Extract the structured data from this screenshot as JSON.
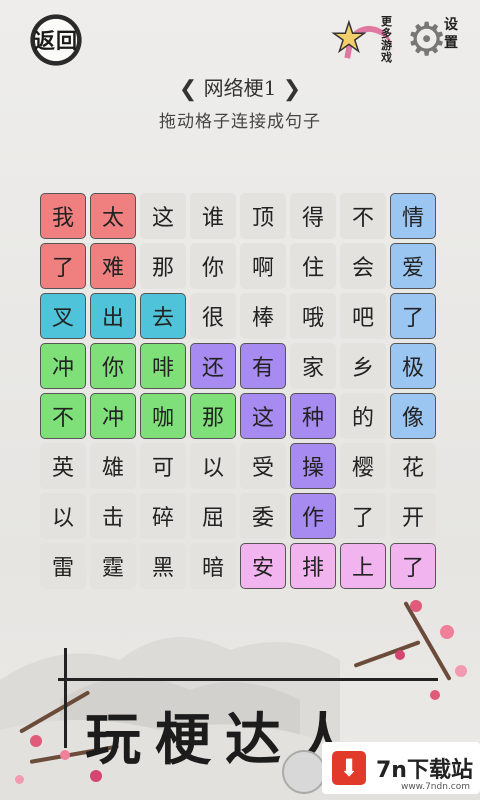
{
  "top": {
    "back_label": "返回",
    "more_games_label": "更多游戏",
    "settings_label": "设置"
  },
  "level": {
    "title": "网络梗1",
    "prev_arrow": "❮",
    "next_arrow": "❯",
    "hint": "拖动格子连接成句子"
  },
  "grid": [
    [
      {
        "t": "我",
        "c": "red"
      },
      {
        "t": "太",
        "c": "red"
      },
      {
        "t": "这",
        "c": ""
      },
      {
        "t": "谁",
        "c": ""
      },
      {
        "t": "顶",
        "c": ""
      },
      {
        "t": "得",
        "c": ""
      },
      {
        "t": "不",
        "c": ""
      },
      {
        "t": "情",
        "c": "blue"
      }
    ],
    [
      {
        "t": "了",
        "c": "red"
      },
      {
        "t": "难",
        "c": "red"
      },
      {
        "t": "那",
        "c": ""
      },
      {
        "t": "你",
        "c": ""
      },
      {
        "t": "啊",
        "c": ""
      },
      {
        "t": "住",
        "c": ""
      },
      {
        "t": "会",
        "c": ""
      },
      {
        "t": "爱",
        "c": "blue"
      }
    ],
    [
      {
        "t": "叉",
        "c": "cyan"
      },
      {
        "t": "出",
        "c": "cyan"
      },
      {
        "t": "去",
        "c": "cyan"
      },
      {
        "t": "很",
        "c": ""
      },
      {
        "t": "棒",
        "c": ""
      },
      {
        "t": "哦",
        "c": ""
      },
      {
        "t": "吧",
        "c": ""
      },
      {
        "t": "了",
        "c": "blue"
      }
    ],
    [
      {
        "t": "冲",
        "c": "green"
      },
      {
        "t": "你",
        "c": "green"
      },
      {
        "t": "啡",
        "c": "green"
      },
      {
        "t": "还",
        "c": "purple"
      },
      {
        "t": "有",
        "c": "purple"
      },
      {
        "t": "家",
        "c": ""
      },
      {
        "t": "乡",
        "c": ""
      },
      {
        "t": "极",
        "c": "blue"
      }
    ],
    [
      {
        "t": "不",
        "c": "green"
      },
      {
        "t": "冲",
        "c": "green"
      },
      {
        "t": "咖",
        "c": "green"
      },
      {
        "t": "那",
        "c": "green"
      },
      {
        "t": "这",
        "c": "purple"
      },
      {
        "t": "种",
        "c": "purple"
      },
      {
        "t": "的",
        "c": ""
      },
      {
        "t": "像",
        "c": "blue"
      }
    ],
    [
      {
        "t": "英",
        "c": ""
      },
      {
        "t": "雄",
        "c": ""
      },
      {
        "t": "可",
        "c": ""
      },
      {
        "t": "以",
        "c": ""
      },
      {
        "t": "受",
        "c": ""
      },
      {
        "t": "操",
        "c": "purple"
      },
      {
        "t": "樱",
        "c": ""
      },
      {
        "t": "花",
        "c": ""
      }
    ],
    [
      {
        "t": "以",
        "c": ""
      },
      {
        "t": "击",
        "c": ""
      },
      {
        "t": "碎",
        "c": ""
      },
      {
        "t": "屈",
        "c": ""
      },
      {
        "t": "委",
        "c": ""
      },
      {
        "t": "作",
        "c": "purple"
      },
      {
        "t": "了",
        "c": ""
      },
      {
        "t": "开",
        "c": ""
      }
    ],
    [
      {
        "t": "雷",
        "c": ""
      },
      {
        "t": "霆",
        "c": ""
      },
      {
        "t": "黑",
        "c": ""
      },
      {
        "t": "暗",
        "c": ""
      },
      {
        "t": "安",
        "c": "pink"
      },
      {
        "t": "排",
        "c": "pink"
      },
      {
        "t": "上",
        "c": "pink"
      },
      {
        "t": "了",
        "c": "pink"
      }
    ]
  ],
  "banner": {
    "title": "玩梗达人"
  },
  "watermark": {
    "icon": "download-icon",
    "text": "7n下载站",
    "url_text": "www.7ndn.com"
  },
  "colors": {
    "red": "#f08080",
    "cyan": "#4fc3d9",
    "green": "#7fe07a",
    "purple": "#a78bf0",
    "blue": "#9cc6f2",
    "pink": "#f2b4ee",
    "empty": "#e3e2df"
  }
}
